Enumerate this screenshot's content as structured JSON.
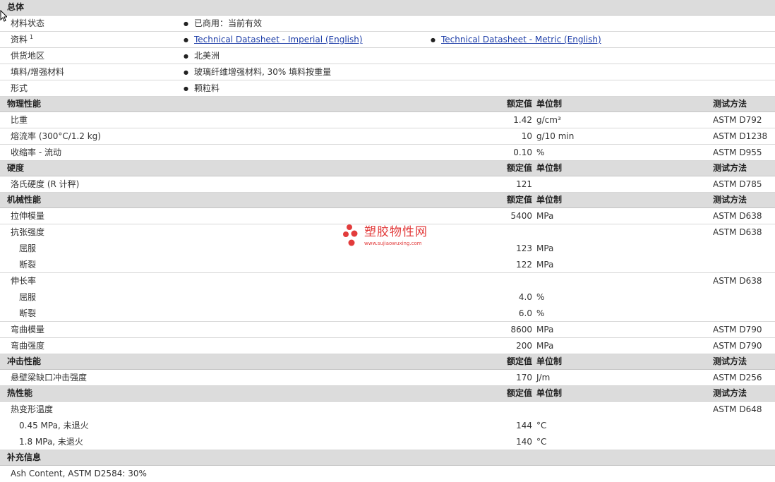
{
  "sections": [
    {
      "title": "总体",
      "kind": "general",
      "rows": [
        {
          "label": "材料状态",
          "values": [
            "已商用：当前有效"
          ]
        },
        {
          "label": "资料",
          "sup": "1",
          "values": [
            "Technical Datasheet - Imperial (English)",
            "Technical Datasheet - Metric (English)"
          ],
          "links": true
        },
        {
          "label": "供货地区",
          "values": [
            "北美洲"
          ]
        },
        {
          "label": "填料/增强材料",
          "values": [
            "玻璃纤维增强材料, 30% 填料按重量"
          ]
        },
        {
          "label": "形式",
          "values": [
            "颗粒料"
          ]
        }
      ]
    },
    {
      "title": "物理性能",
      "kind": "props",
      "rows": [
        {
          "name": "比重",
          "value": "1.42",
          "unit": "g/cm³",
          "test": "ASTM D792"
        },
        {
          "name": "熔流率 (300°C/1.2 kg)",
          "value": "10",
          "unit": "g/10 min",
          "test": "ASTM D1238"
        },
        {
          "name": "收缩率 - 流动",
          "value": "0.10",
          "unit": "%",
          "test": "ASTM D955"
        }
      ]
    },
    {
      "title": "硬度",
      "kind": "props",
      "rows": [
        {
          "name": "洛氏硬度 (R 计秤)",
          "value": "121",
          "unit": "",
          "test": "ASTM D785"
        }
      ]
    },
    {
      "title": "机械性能",
      "kind": "props",
      "rows": [
        {
          "name": "拉伸模量",
          "value": "5400",
          "unit": "MPa",
          "test": "ASTM D638"
        },
        {
          "name": "抗张强度",
          "value": "",
          "unit": "",
          "test": "ASTM D638",
          "group_start": true
        },
        {
          "name": "屈服",
          "value": "123",
          "unit": "MPa",
          "test": "",
          "indent": true
        },
        {
          "name": "断裂",
          "value": "122",
          "unit": "MPa",
          "test": "",
          "indent": true
        },
        {
          "name": "伸长率",
          "value": "",
          "unit": "",
          "test": "ASTM D638",
          "group_start": true
        },
        {
          "name": "屈服",
          "value": "4.0",
          "unit": "%",
          "test": "",
          "indent": true
        },
        {
          "name": "断裂",
          "value": "6.0",
          "unit": "%",
          "test": "",
          "indent": true
        },
        {
          "name": "弯曲模量",
          "value": "8600",
          "unit": "MPa",
          "test": "ASTM D790"
        },
        {
          "name": "弯曲强度",
          "value": "200",
          "unit": "MPa",
          "test": "ASTM D790"
        }
      ]
    },
    {
      "title": "冲击性能",
      "kind": "props",
      "rows": [
        {
          "name": "悬壁梁缺口冲击强度",
          "value": "170",
          "unit": "J/m",
          "test": "ASTM D256"
        }
      ]
    },
    {
      "title": "热性能",
      "kind": "props",
      "rows": [
        {
          "name": "热变形温度",
          "value": "",
          "unit": "",
          "test": "ASTM D648"
        },
        {
          "name": "0.45 MPa, 未退火",
          "value": "144",
          "unit": "°C",
          "test": "",
          "indent": true
        },
        {
          "name": "1.8 MPa, 未退火",
          "value": "140",
          "unit": "°C",
          "test": "",
          "indent": true
        }
      ]
    },
    {
      "title": "补充信息",
      "kind": "note",
      "rows": [
        {
          "name": "Ash Content, ASTM D2584: 30%"
        }
      ]
    }
  ],
  "headers": {
    "nominal": "额定值",
    "unit": "单位制",
    "test": "测试方法"
  },
  "watermark": {
    "text": "塑胶物性网",
    "url": "www.sujiaowuxing.com"
  },
  "colors": {
    "section_bg": "#dcdcdc",
    "link": "#1e3ea8",
    "watermark": "#e23b3b"
  },
  "icons": {
    "cursor": "mouse-pointer-icon",
    "bullet": "bullet-dot-icon"
  }
}
